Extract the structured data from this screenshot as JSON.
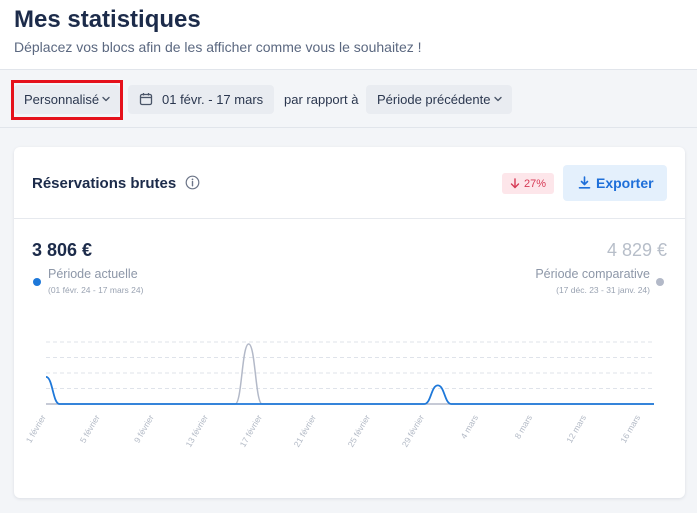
{
  "header": {
    "title": "Mes statistiques",
    "subtitle": "Déplacez vos blocs afin de les afficher comme vous le souhaitez !"
  },
  "filters": {
    "period_select": "Personnalisé",
    "date_range": "01 févr. - 17 mars",
    "compare_label": "par rapport à",
    "compare_select": "Période précédente"
  },
  "card": {
    "title": "Réservations brutes",
    "delta": "27%",
    "export_label": "Exporter",
    "current": {
      "value": "3 806 €",
      "label": "Période actuelle",
      "range": "(01 févr. 24 - 17 mars 24)"
    },
    "comparison": {
      "value": "4 829 €",
      "label": "Période comparative",
      "range": "(17 déc. 23 - 31 janv. 24)"
    }
  },
  "colors": {
    "current_series": "#1e78d9",
    "comparison_series": "#b3b9c8",
    "delta_negative": "#d63a55",
    "highlight": "#e5111b"
  },
  "icons": {
    "period_chevron": "chevron-down-icon",
    "date": "calendar-icon",
    "compare_chevron": "chevron-down-icon",
    "info": "info-icon",
    "delta": "arrow-down-icon",
    "export": "download-icon"
  },
  "chart_data": {
    "type": "line",
    "title": "",
    "xlabel": "",
    "ylabel": "",
    "grid": true,
    "x": [
      "1 février",
      "2",
      "3",
      "4",
      "5 février",
      "6",
      "7",
      "8",
      "9 février",
      "10",
      "11",
      "12",
      "13 février",
      "14",
      "15",
      "16",
      "17 février",
      "18",
      "19",
      "20",
      "21 février",
      "22",
      "23",
      "24",
      "25 février",
      "26",
      "27",
      "28",
      "29 février",
      "1",
      "2",
      "3",
      "4 mars",
      "5",
      "6",
      "7",
      "8 mars",
      "9",
      "10",
      "11",
      "12 mars",
      "13",
      "14",
      "15",
      "16 mars",
      "17"
    ],
    "tick_labels": [
      "1 février",
      "5 février",
      "9 février",
      "13 février",
      "17 février",
      "21 février",
      "25 février",
      "29 février",
      "4 mars",
      "8 mars",
      "12 mars",
      "16 mars"
    ],
    "ylim": [
      0,
      1600
    ],
    "series": [
      {
        "name": "Période actuelle",
        "values": [
          700,
          0,
          0,
          0,
          0,
          0,
          0,
          0,
          0,
          0,
          0,
          0,
          0,
          0,
          0,
          0,
          0,
          0,
          0,
          0,
          0,
          0,
          0,
          0,
          0,
          0,
          0,
          0,
          0,
          480,
          0,
          0,
          0,
          0,
          0,
          0,
          0,
          0,
          0,
          0,
          0,
          0,
          0,
          0,
          0,
          0
        ]
      },
      {
        "name": "Période comparative",
        "values": [
          0,
          0,
          0,
          0,
          0,
          0,
          0,
          0,
          0,
          0,
          0,
          0,
          0,
          0,
          0,
          1550,
          0,
          0,
          0,
          0,
          0,
          0,
          0,
          0,
          0,
          0,
          0,
          0,
          0,
          0,
          0,
          0,
          0,
          0,
          0,
          0,
          0,
          0,
          0,
          0,
          0,
          0,
          0,
          0,
          0,
          0
        ]
      }
    ]
  }
}
